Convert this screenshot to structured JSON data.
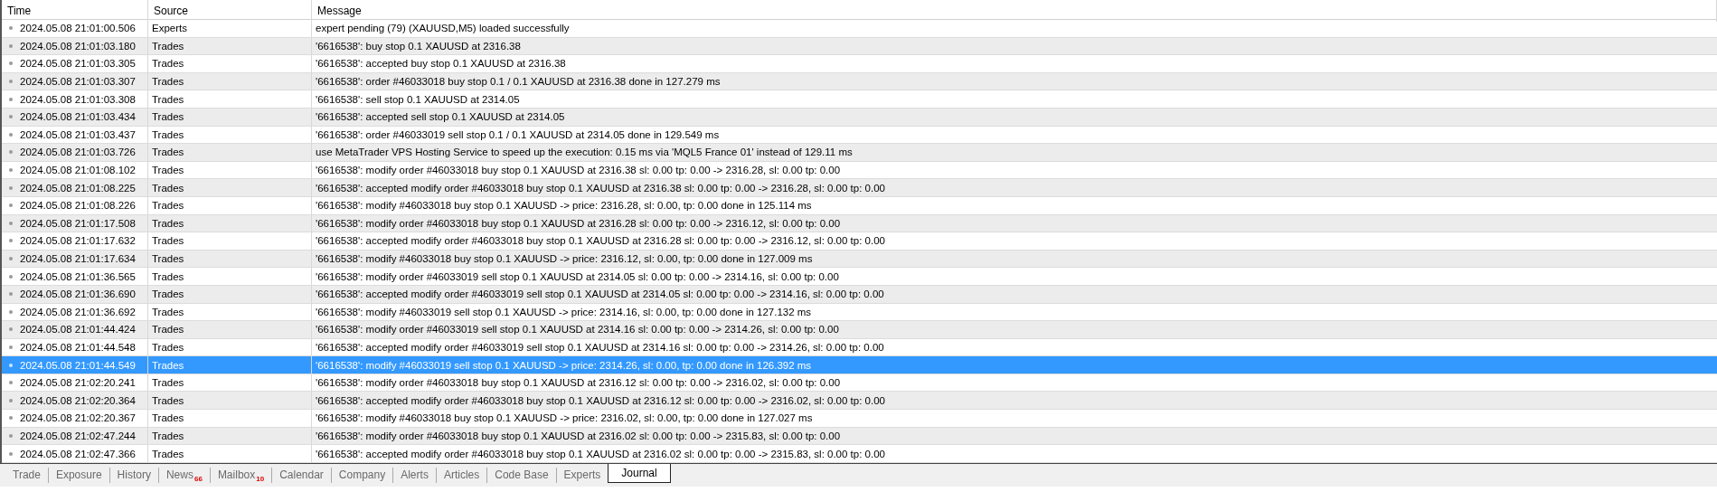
{
  "table": {
    "columns": [
      "Time",
      "Source",
      "Message"
    ],
    "rows": [
      {
        "time": "2024.05.08 21:01:00.506",
        "source": "Experts",
        "message": "expert pending (79) (XAUUSD,M5) loaded successfully",
        "selected": false
      },
      {
        "time": "2024.05.08 21:01:03.180",
        "source": "Trades",
        "message": "'6616538': buy stop 0.1 XAUUSD at 2316.38",
        "selected": false
      },
      {
        "time": "2024.05.08 21:01:03.305",
        "source": "Trades",
        "message": "'6616538': accepted buy stop 0.1 XAUUSD at 2316.38",
        "selected": false
      },
      {
        "time": "2024.05.08 21:01:03.307",
        "source": "Trades",
        "message": "'6616538': order #46033018 buy stop 0.1 / 0.1 XAUUSD at 2316.38 done in 127.279 ms",
        "selected": false
      },
      {
        "time": "2024.05.08 21:01:03.308",
        "source": "Trades",
        "message": "'6616538': sell stop 0.1 XAUUSD at 2314.05",
        "selected": false
      },
      {
        "time": "2024.05.08 21:01:03.434",
        "source": "Trades",
        "message": "'6616538': accepted sell stop 0.1 XAUUSD at 2314.05",
        "selected": false
      },
      {
        "time": "2024.05.08 21:01:03.437",
        "source": "Trades",
        "message": "'6616538': order #46033019 sell stop 0.1 / 0.1 XAUUSD at 2314.05 done in 129.549 ms",
        "selected": false
      },
      {
        "time": "2024.05.08 21:01:03.726",
        "source": "Trades",
        "message": "use MetaTrader VPS Hosting Service to speed up the execution: 0.15 ms via 'MQL5 France 01' instead of 129.11 ms",
        "selected": false
      },
      {
        "time": "2024.05.08 21:01:08.102",
        "source": "Trades",
        "message": "'6616538': modify order #46033018 buy stop 0.1 XAUUSD at 2316.38 sl: 0.00 tp: 0.00 -> 2316.28, sl: 0.00 tp: 0.00",
        "selected": false
      },
      {
        "time": "2024.05.08 21:01:08.225",
        "source": "Trades",
        "message": "'6616538': accepted modify order #46033018 buy stop 0.1 XAUUSD at 2316.38 sl: 0.00 tp: 0.00 -> 2316.28, sl: 0.00 tp: 0.00",
        "selected": false
      },
      {
        "time": "2024.05.08 21:01:08.226",
        "source": "Trades",
        "message": "'6616538': modify #46033018 buy stop 0.1 XAUUSD -> price: 2316.28, sl: 0.00, tp: 0.00 done in 125.114 ms",
        "selected": false
      },
      {
        "time": "2024.05.08 21:01:17.508",
        "source": "Trades",
        "message": "'6616538': modify order #46033018 buy stop 0.1 XAUUSD at 2316.28 sl: 0.00 tp: 0.00 -> 2316.12, sl: 0.00 tp: 0.00",
        "selected": false
      },
      {
        "time": "2024.05.08 21:01:17.632",
        "source": "Trades",
        "message": "'6616538': accepted modify order #46033018 buy stop 0.1 XAUUSD at 2316.28 sl: 0.00 tp: 0.00 -> 2316.12, sl: 0.00 tp: 0.00",
        "selected": false
      },
      {
        "time": "2024.05.08 21:01:17.634",
        "source": "Trades",
        "message": "'6616538': modify #46033018 buy stop 0.1 XAUUSD -> price: 2316.12, sl: 0.00, tp: 0.00 done in 127.009 ms",
        "selected": false
      },
      {
        "time": "2024.05.08 21:01:36.565",
        "source": "Trades",
        "message": "'6616538': modify order #46033019 sell stop 0.1 XAUUSD at 2314.05 sl: 0.00 tp: 0.00 -> 2314.16, sl: 0.00 tp: 0.00",
        "selected": false
      },
      {
        "time": "2024.05.08 21:01:36.690",
        "source": "Trades",
        "message": "'6616538': accepted modify order #46033019 sell stop 0.1 XAUUSD at 2314.05 sl: 0.00 tp: 0.00 -> 2314.16, sl: 0.00 tp: 0.00",
        "selected": false
      },
      {
        "time": "2024.05.08 21:01:36.692",
        "source": "Trades",
        "message": "'6616538': modify #46033019 sell stop 0.1 XAUUSD -> price: 2314.16, sl: 0.00, tp: 0.00 done in 127.132 ms",
        "selected": false
      },
      {
        "time": "2024.05.08 21:01:44.424",
        "source": "Trades",
        "message": "'6616538': modify order #46033019 sell stop 0.1 XAUUSD at 2314.16 sl: 0.00 tp: 0.00 -> 2314.26, sl: 0.00 tp: 0.00",
        "selected": false
      },
      {
        "time": "2024.05.08 21:01:44.548",
        "source": "Trades",
        "message": "'6616538': accepted modify order #46033019 sell stop 0.1 XAUUSD at 2314.16 sl: 0.00 tp: 0.00 -> 2314.26, sl: 0.00 tp: 0.00",
        "selected": false
      },
      {
        "time": "2024.05.08 21:01:44.549",
        "source": "Trades",
        "message": "'6616538': modify #46033019 sell stop 0.1 XAUUSD -> price: 2314.26, sl: 0.00, tp: 0.00 done in 126.392 ms",
        "selected": true
      },
      {
        "time": "2024.05.08 21:02:20.241",
        "source": "Trades",
        "message": "'6616538': modify order #46033018 buy stop 0.1 XAUUSD at 2316.12 sl: 0.00 tp: 0.00 -> 2316.02, sl: 0.00 tp: 0.00",
        "selected": false
      },
      {
        "time": "2024.05.08 21:02:20.364",
        "source": "Trades",
        "message": "'6616538': accepted modify order #46033018 buy stop 0.1 XAUUSD at 2316.12 sl: 0.00 tp: 0.00 -> 2316.02, sl: 0.00 tp: 0.00",
        "selected": false
      },
      {
        "time": "2024.05.08 21:02:20.367",
        "source": "Trades",
        "message": "'6616538': modify #46033018 buy stop 0.1 XAUUSD -> price: 2316.02, sl: 0.00, tp: 0.00 done in 127.027 ms",
        "selected": false
      },
      {
        "time": "2024.05.08 21:02:47.244",
        "source": "Trades",
        "message": "'6616538': modify order #46033018 buy stop 0.1 XAUUSD at 2316.02 sl: 0.00 tp: 0.00 -> 2315.83, sl: 0.00 tp: 0.00",
        "selected": false
      },
      {
        "time": "2024.05.08 21:02:47.366",
        "source": "Trades",
        "message": "'6616538': accepted modify order #46033018 buy stop 0.1 XAUUSD at 2316.02 sl: 0.00 tp: 0.00 -> 2315.83, sl: 0.00 tp: 0.00",
        "selected": false
      }
    ]
  },
  "tabs": [
    {
      "label": "Trade",
      "selected": false
    },
    {
      "label": "Exposure",
      "selected": false
    },
    {
      "label": "History",
      "selected": false
    },
    {
      "label": "News",
      "count": "66",
      "selected": false
    },
    {
      "label": "Mailbox",
      "count": "10",
      "selected": false
    },
    {
      "label": "Calendar",
      "selected": false
    },
    {
      "label": "Company",
      "selected": false
    },
    {
      "label": "Alerts",
      "selected": false
    },
    {
      "label": "Articles",
      "selected": false
    },
    {
      "label": "Code Base",
      "selected": false
    },
    {
      "label": "Experts",
      "selected": false
    },
    {
      "label": "Journal",
      "selected": true
    }
  ]
}
